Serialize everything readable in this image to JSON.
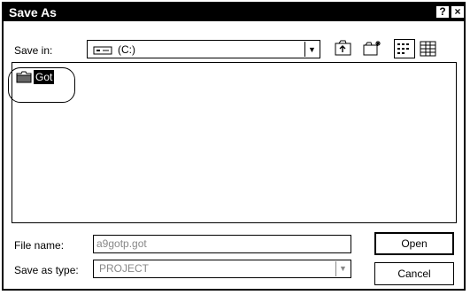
{
  "window": {
    "title": "Save As",
    "help_label": "?",
    "close_label": "×"
  },
  "save_in": {
    "label": "Save in:",
    "value": "(C:)",
    "icon": "drive-icon"
  },
  "toolbar": {
    "buttons": [
      "up-one-level-icon",
      "new-folder-icon",
      "list-view-icon",
      "details-view-icon"
    ]
  },
  "file_list": {
    "items": [
      {
        "name": "Got",
        "icon": "folder-icon"
      }
    ]
  },
  "file_name": {
    "label": "File name:",
    "value": "a9gotp.got"
  },
  "save_as_type": {
    "label": "Save as type:",
    "value": "PROJECT"
  },
  "buttons": {
    "open": "Open",
    "cancel": "Cancel"
  }
}
